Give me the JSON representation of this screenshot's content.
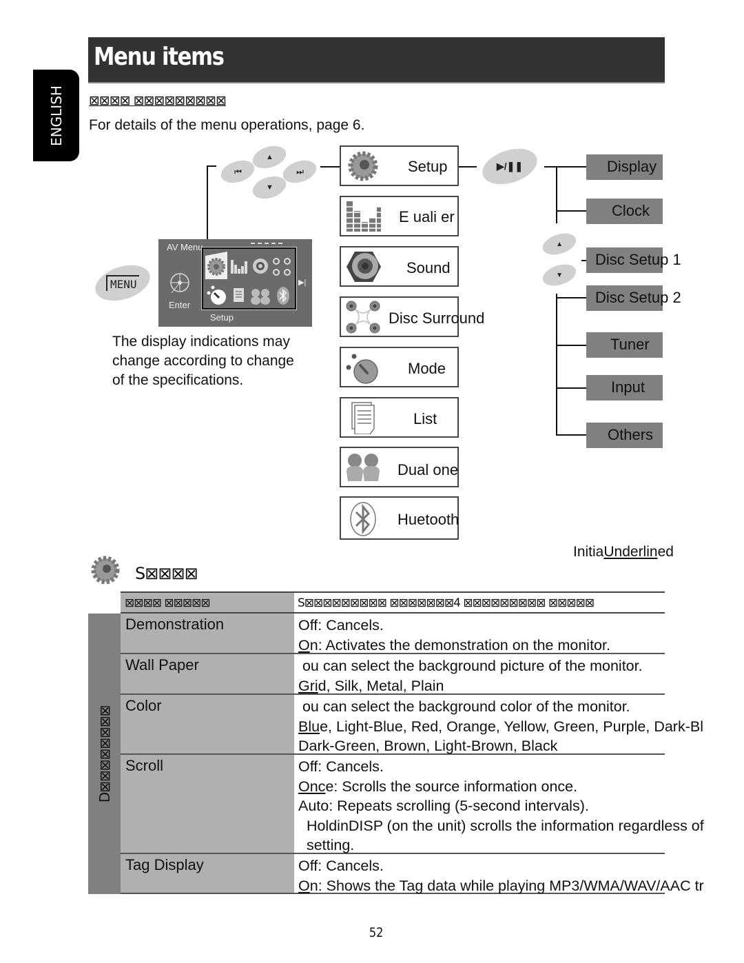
{
  "header": {
    "title": "Menu items",
    "language_tab": "ENGLISH"
  },
  "section": {
    "subheading": "⊠⊠⊠⊠ ⊠⊠⊠⊠⊠⊠⊠⊠⊠",
    "intro": "For details of the menu operations,   page 6."
  },
  "diagram": {
    "buttons": {
      "menu": "MENU",
      "prev": "⏮",
      "next": "⏭",
      "up": "▲",
      "down": "▼",
      "play_pause": "▶/❚❚"
    },
    "av_screen": {
      "title": "AV Menu",
      "enter": "Enter",
      "selected": "Setup"
    },
    "note": [
      "The display indications may",
      "change according to change",
      "of the specifications."
    ],
    "main_menu": [
      {
        "label": "Setup",
        "icon": "gear-icon"
      },
      {
        "label": "E uali er",
        "icon": "equalizer-icon"
      },
      {
        "label": "Sound",
        "icon": "speaker-icon"
      },
      {
        "label": "Disc Surround",
        "icon": "surround-icon"
      },
      {
        "label": "Mode",
        "icon": "mode-dial-icon"
      },
      {
        "label": "List",
        "icon": "list-icon"
      },
      {
        "label": "Dual  one",
        "icon": "dual-zone-icon"
      },
      {
        "label": "Huetooth",
        "icon": "bluetooth-icon"
      }
    ],
    "sub_menu": [
      "Display",
      "Clock",
      "Disc Setup 1",
      "Disc Setup 2",
      "Tuner",
      "Input",
      "Others"
    ]
  },
  "initial_note": {
    "prefix": "Initia",
    "underlined": "Underlin",
    "suffix": "ed"
  },
  "setup_section": {
    "heading": "S⊠⊠⊠⊠"
  },
  "table": {
    "header_item": "⊠⊠⊠⊠ ⊠⊠⊠⊠⊠",
    "header_setting": "S⊠⊠⊠⊠⊠⊠⊠⊠⊠ ⊠⊠⊠⊠⊠⊠⊠4 ⊠⊠⊠⊠⊠⊠⊠⊠⊠ ⊠⊠⊠⊠⊠",
    "group_label": "D⊠⊠⊠⊠⊠⊠⊠⊠",
    "rows": [
      {
        "name": "Demonstration",
        "lines": [
          {
            "u": "",
            "t": "Off: Cancels."
          },
          {
            "u": "O",
            "t": "n: Activates the demonstration on the monitor."
          }
        ]
      },
      {
        "name": "Wall Paper",
        "lines": [
          {
            "u": "",
            "t": " ou can select the background picture of the monitor."
          },
          {
            "u": "Gri",
            "t": "d, Silk, Metal, Plain"
          }
        ]
      },
      {
        "name": "Color",
        "lines": [
          {
            "u": "",
            "t": " ou can select the background color of the monitor."
          },
          {
            "u": "Blu",
            "t": "e, Light-Blue, Red, Orange, Yellow, Green, Purple, Dark-Bl"
          },
          {
            "u": "",
            "t": "Dark-Green, Brown, Light-Brown, Black"
          }
        ]
      },
      {
        "name": "Scroll",
        "lines": [
          {
            "u": "",
            "t": "Off: Cancels."
          },
          {
            "u": "Onc",
            "t": "e: Scrolls the source information once."
          },
          {
            "u": "",
            "t": "Auto: Repeats scrolling (5-second intervals)."
          },
          {
            "u": "",
            "t": "  HoldinDISP (on the unit) scrolls the information regardless of"
          },
          {
            "u": "",
            "t": "  setting."
          }
        ]
      },
      {
        "name": "Tag Display",
        "lines": [
          {
            "u": "",
            "t": "Off: Cancels."
          },
          {
            "u": "O",
            "t": "n: Shows the Tag data while playing MP3/WMA/WAV/AAC tr"
          }
        ]
      }
    ]
  },
  "footer": {
    "page_number": "52"
  }
}
